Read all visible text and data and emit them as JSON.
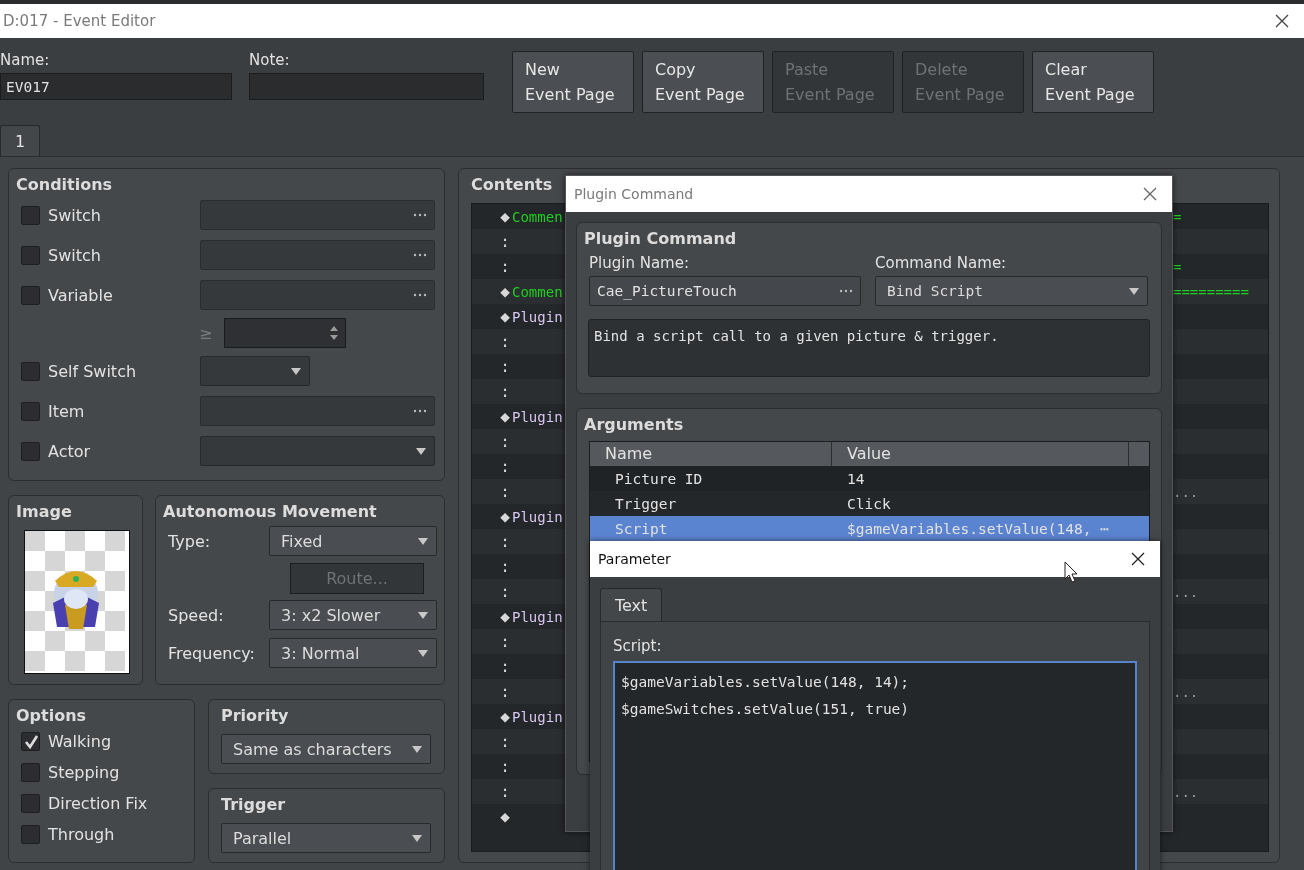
{
  "window": {
    "title": "D:017 - Event Editor"
  },
  "name": {
    "label": "Name:",
    "value": "EV017"
  },
  "note": {
    "label": "Note:"
  },
  "page_buttons": [
    {
      "lines": [
        "New",
        "Event Page"
      ],
      "disabled": false
    },
    {
      "lines": [
        "Copy",
        "Event Page"
      ],
      "disabled": false
    },
    {
      "lines": [
        "Paste",
        "Event Page"
      ],
      "disabled": true
    },
    {
      "lines": [
        "Delete",
        "Event Page"
      ],
      "disabled": true
    },
    {
      "lines": [
        "Clear",
        "Event Page"
      ],
      "disabled": false
    }
  ],
  "tabs": [
    {
      "label": "1",
      "selected": true
    }
  ],
  "conditions": {
    "title": "Conditions",
    "rows": [
      {
        "kind": "picker",
        "label": "Switch",
        "checked": false
      },
      {
        "kind": "picker",
        "label": "Switch",
        "checked": false
      },
      {
        "kind": "picker",
        "label": "Variable",
        "checked": false
      },
      {
        "kind": "compare",
        "symbol": "≥"
      },
      {
        "kind": "short",
        "label": "Self Switch",
        "checked": false
      },
      {
        "kind": "picker",
        "label": "Item",
        "checked": false
      },
      {
        "kind": "dropdown",
        "label": "Actor",
        "checked": false
      }
    ]
  },
  "image": {
    "title": "Image"
  },
  "autonomous_movement": {
    "title": "Autonomous Movement",
    "type": {
      "label": "Type:",
      "value": "Fixed"
    },
    "route_button": {
      "label": "Route...",
      "disabled": true
    },
    "speed": {
      "label": "Speed:",
      "value": "3: x2 Slower"
    },
    "frequency": {
      "label": "Frequency:",
      "value": "3: Normal"
    }
  },
  "options": {
    "title": "Options",
    "items": [
      {
        "label": "Walking",
        "checked": true
      },
      {
        "label": "Stepping",
        "checked": false
      },
      {
        "label": "Direction Fix",
        "checked": false
      },
      {
        "label": "Through",
        "checked": false
      }
    ]
  },
  "priority": {
    "title": "Priority",
    "value": "Same as characters"
  },
  "trigger": {
    "title": "Trigger",
    "value": "Parallel"
  },
  "contents": {
    "title": "Contents",
    "rows": [
      {
        "kind": "comment",
        "marker": "◆",
        "text": "Commen",
        "tail": "="
      },
      {
        "kind": "comment",
        "marker": ":"
      },
      {
        "kind": "comment",
        "marker": ":",
        "tail": "="
      },
      {
        "kind": "comment",
        "marker": "◆",
        "text": "Commen",
        "tail": "========="
      },
      {
        "kind": "plugin",
        "marker": "◆",
        "text": "Plugin"
      },
      {
        "kind": "plugin",
        "marker": ":"
      },
      {
        "kind": "plugin",
        "marker": ":"
      },
      {
        "kind": "plugin",
        "marker": ":"
      },
      {
        "kind": "plugin",
        "marker": "◆",
        "text": "Plugin"
      },
      {
        "kind": "plugin",
        "marker": ":"
      },
      {
        "kind": "plugin",
        "marker": ":"
      },
      {
        "kind": "plugin",
        "marker": ":",
        "tail": "..."
      },
      {
        "kind": "plugin",
        "marker": "◆",
        "text": "Plugin"
      },
      {
        "kind": "plugin",
        "marker": ":"
      },
      {
        "kind": "plugin",
        "marker": ":"
      },
      {
        "kind": "plugin",
        "marker": ":",
        "tail": "..."
      },
      {
        "kind": "plugin",
        "marker": "◆",
        "text": "Plugin"
      },
      {
        "kind": "plugin",
        "marker": ":"
      },
      {
        "kind": "plugin",
        "marker": ":"
      },
      {
        "kind": "plugin",
        "marker": ":",
        "tail": "..."
      },
      {
        "kind": "plugin",
        "marker": "◆",
        "text": "Plugin"
      },
      {
        "kind": "plugin",
        "marker": ":"
      },
      {
        "kind": "plugin",
        "marker": ":"
      },
      {
        "kind": "plugin",
        "marker": ":",
        "tail": "..."
      },
      {
        "kind": "end",
        "marker": "◆"
      }
    ]
  },
  "plugin_command_dialog": {
    "title": "Plugin Command",
    "group_title": "Plugin Command",
    "plugin_name": {
      "label": "Plugin Name:",
      "value": "Cae_PictureTouch"
    },
    "command_name": {
      "label": "Command Name:",
      "value": "Bind Script"
    },
    "description": "Bind a script call to a given picture & trigger.",
    "arguments": {
      "title": "Arguments",
      "columns": [
        "Name",
        "Value"
      ],
      "rows": [
        {
          "name": "Picture ID",
          "value": "14",
          "selected": false
        },
        {
          "name": "Trigger",
          "value": "Click",
          "selected": false
        },
        {
          "name": "Script",
          "value": "$gameVariables.setValue(148, ⋯",
          "selected": true
        }
      ]
    }
  },
  "parameter_dialog": {
    "title": "Parameter",
    "tabs": [
      {
        "label": "Text",
        "selected": true
      }
    ],
    "label": "Script:",
    "value": "$gameVariables.setValue(148, 14);\n$gameSwitches.setValue(151, true)"
  }
}
